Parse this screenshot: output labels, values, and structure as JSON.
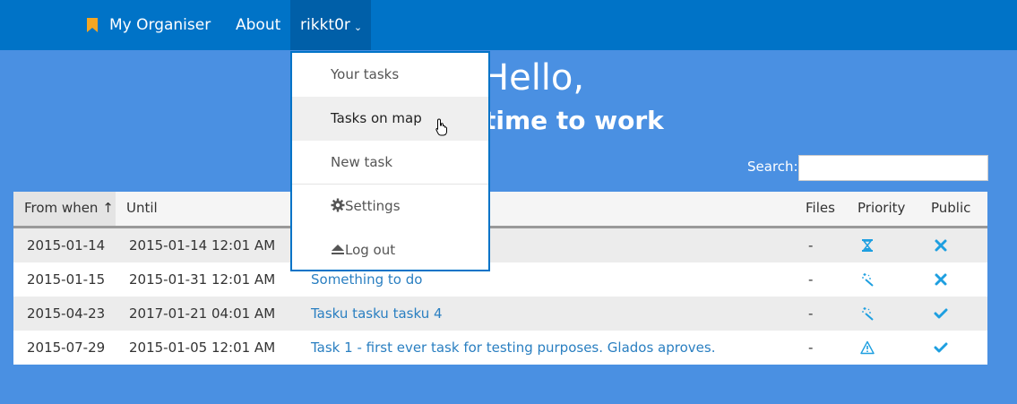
{
  "navbar": {
    "brand": "My Organiser",
    "brand_icon": "bookmark-icon",
    "about": "About",
    "user": "rikkt0r",
    "user_chevron": "chevron-down-icon",
    "bg_color": "#0073c7"
  },
  "hero": {
    "title": "Hello,",
    "subtitle": "time to work"
  },
  "search": {
    "label": "Search:",
    "value": ""
  },
  "table": {
    "columns": [
      "From when",
      "Until",
      "",
      "Files",
      "Priority",
      "Public"
    ],
    "sort_indicator": "↑",
    "rows": [
      {
        "from": "2015-01-14",
        "until": "2015-01-14 12:01 AM",
        "name": "",
        "files": "-",
        "priority_icon": "hourglass-icon",
        "public_icon": "cross-icon"
      },
      {
        "from": "2015-01-15",
        "until": "2015-01-31 12:01 AM",
        "name": "Something to do",
        "files": "-",
        "priority_icon": "magic-wand-icon",
        "public_icon": "cross-icon"
      },
      {
        "from": "2015-04-23",
        "until": "2017-01-21 04:01 AM",
        "name": "Tasku tasku tasku 4",
        "files": "-",
        "priority_icon": "magic-wand-icon",
        "public_icon": "check-icon"
      },
      {
        "from": "2015-07-29",
        "until": "2015-01-05 12:01 AM",
        "name": "Task 1 - first ever task for testing purposes. Glados aproves.",
        "files": "-",
        "priority_icon": "warning-icon",
        "public_icon": "check-icon"
      }
    ]
  },
  "dropdown": {
    "items": [
      {
        "label": "Your tasks"
      },
      {
        "label": "Tasks on map"
      },
      {
        "label": "New task"
      },
      {
        "label": "Settings",
        "icon": "gear-icon"
      },
      {
        "label": "Log out",
        "icon": "eject-icon"
      }
    ]
  },
  "colors": {
    "accent": "#2a7fc1",
    "icon_blue": "#1e9fe0",
    "page_bg": "#4a90e2"
  }
}
